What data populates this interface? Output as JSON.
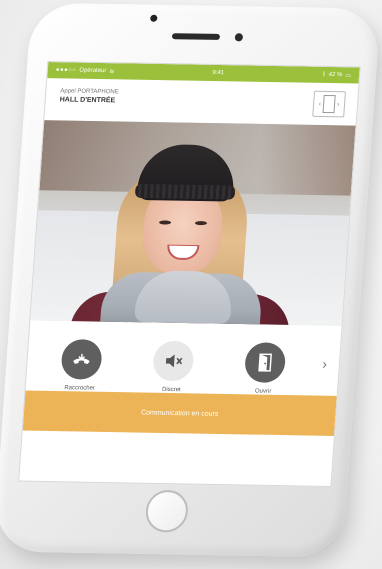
{
  "status_bar": {
    "carrier": "Opérateur",
    "time": "9:41",
    "battery": "42 %"
  },
  "header": {
    "subtitle": "Appel PORTAPHONE",
    "title": "HALL D'ENTRÉE"
  },
  "controls": {
    "hangup_label": "Raccrocher",
    "mute_label": "Discret",
    "open_label": "Ouvrir"
  },
  "call_status": "Communication en cours",
  "colors": {
    "status_bar": "#9bc13c",
    "call_banner": "#ecb456",
    "control_dark": "#5f5f5f",
    "control_light": "#e8e8e8"
  },
  "icons": {
    "hangup": "phone-hangup-icon",
    "mute": "speaker-mute-icon",
    "open": "door-open-icon",
    "switch_camera": "switch-camera-icon",
    "next": "chevron-right-icon"
  }
}
